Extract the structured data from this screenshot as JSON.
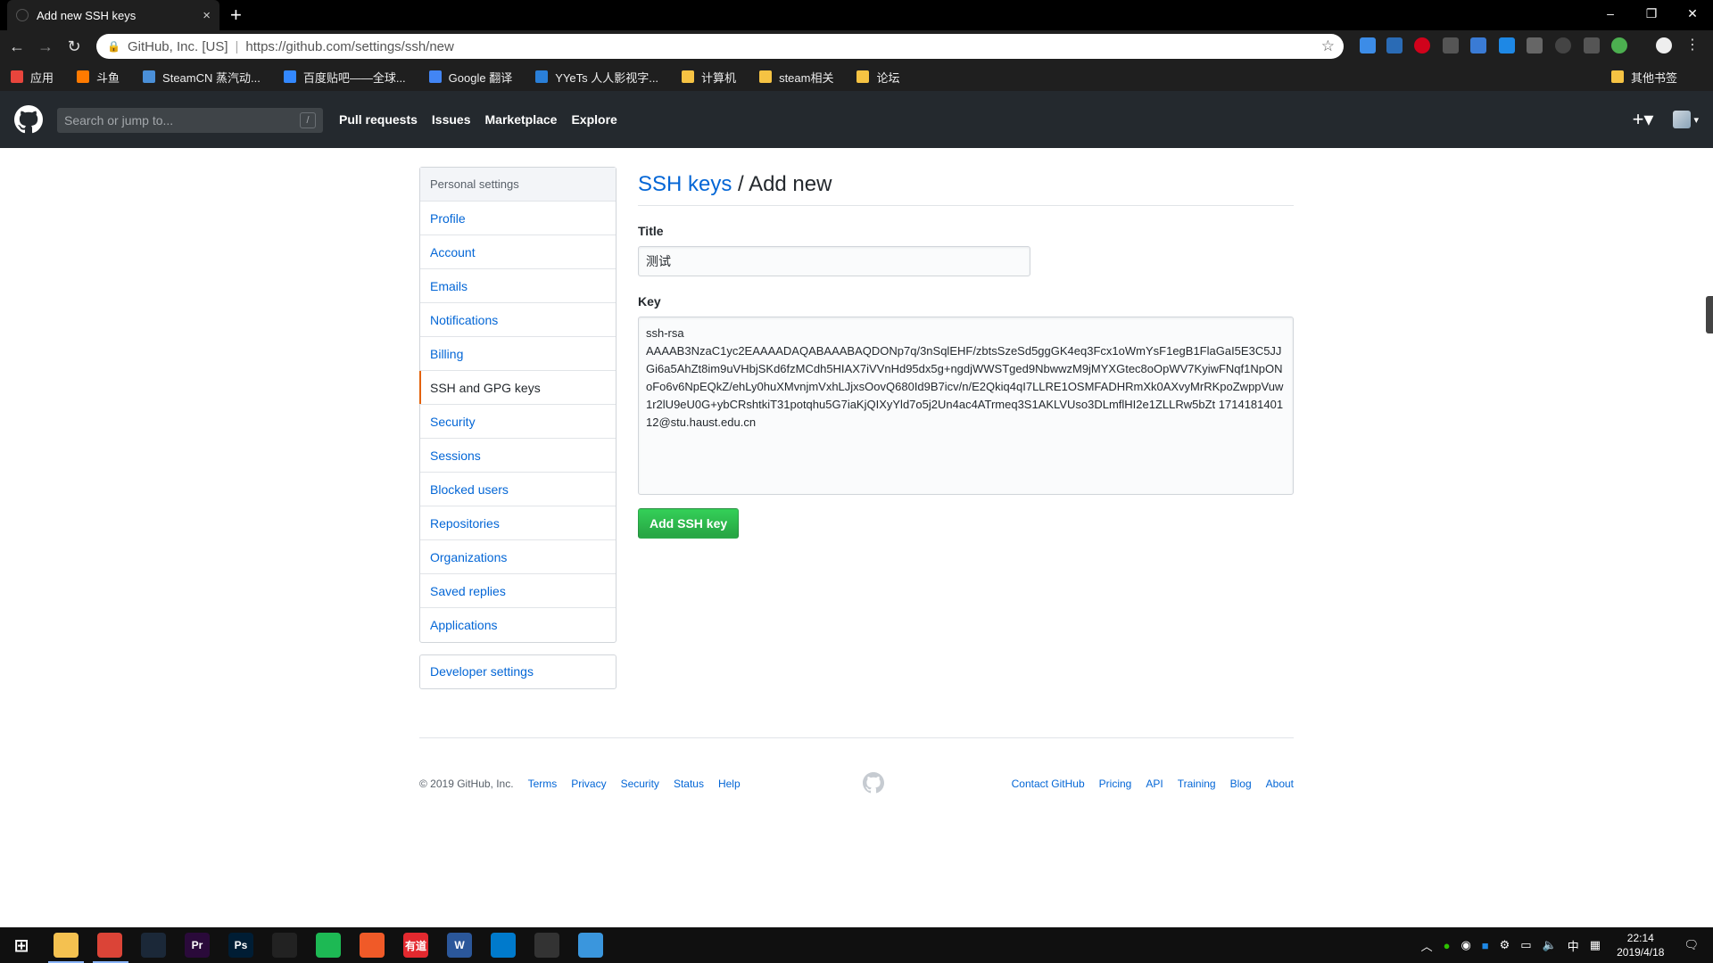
{
  "browser": {
    "tab_title": "Add new SSH keys",
    "tab_close": "×",
    "new_tab": "+",
    "window_controls": [
      "–",
      "❐",
      "✕"
    ],
    "ev_label": "GitHub, Inc. [US]",
    "url": "https://github.com/settings/ssh/new",
    "bookmarks": [
      {
        "label": "应用",
        "color": "#e8453c"
      },
      {
        "label": "斗鱼",
        "color": "#ff7a00"
      },
      {
        "label": "SteamCN 蒸汽动...",
        "color": "#4a8fd8"
      },
      {
        "label": "百度贴吧——全球...",
        "color": "#3388ff"
      },
      {
        "label": "Google 翻译",
        "color": "#4285f4"
      },
      {
        "label": "YYeTs 人人影视字...",
        "color": "#2a7fd8"
      },
      {
        "label": "计算机",
        "color": "#f6c343"
      },
      {
        "label": "steam相关",
        "color": "#f6c343"
      },
      {
        "label": "论坛",
        "color": "#f6c343"
      }
    ],
    "other_bookmarks": "其他书签"
  },
  "gh_header": {
    "search_placeholder": "Search or jump to...",
    "slash_key": "/",
    "nav": [
      "Pull requests",
      "Issues",
      "Marketplace",
      "Explore"
    ],
    "plus": "+▾",
    "avatar_caret": "▾"
  },
  "sidebar": {
    "heading": "Personal settings",
    "items": [
      "Profile",
      "Account",
      "Emails",
      "Notifications",
      "Billing",
      "SSH and GPG keys",
      "Security",
      "Sessions",
      "Blocked users",
      "Repositories",
      "Organizations",
      "Saved replies",
      "Applications"
    ],
    "selected_index": 5,
    "developer_settings": "Developer settings"
  },
  "main": {
    "crumb": "SSH keys",
    "divider": " / ",
    "heading": "Add new",
    "title_label": "Title",
    "title_value": "测试",
    "key_label": "Key",
    "key_value": "ssh-rsa\nAAAAB3NzaC1yc2EAAAADAQABAAABAQDONp7q/3nSqlEHF/zbtsSzeSd5ggGK4eq3Fcx1oWmYsF1egB1FlaGaI5E3C5JJGi6a5AhZt8im9uVHbjSKd6fzMCdh5HIAX7iVVnHd95dx5g+ngdjWWSTged9NbwwzM9jMYXGtec8oOpWV7KyiwFNqf1NpONoFo6v6NpEQkZ/ehLy0huXMvnjmVxhLJjxsOovQ680Id9B7icv/n/E2Qkiq4qI7LLRE1OSMFADHRmXk0AXvyMrRKpoZwppVuw1r2lU9eU0G+ybCRshtkiT31potqhu5G7iaKjQIXyYld7o5j2Un4ac4ATrmeq3S1AKLVUso3DLmflHI2e1ZLLRw5bZt 171418140112@stu.haust.edu.cn",
    "submit": "Add SSH key"
  },
  "footer": {
    "copyright": "© 2019 GitHub, Inc.",
    "left_links": [
      "Terms",
      "Privacy",
      "Security",
      "Status",
      "Help"
    ],
    "right_links": [
      "Contact GitHub",
      "Pricing",
      "API",
      "Training",
      "Blog",
      "About"
    ]
  },
  "taskbar": {
    "apps": [
      {
        "name": "file-explorer",
        "glyph": "",
        "color": "#f4c150"
      },
      {
        "name": "chrome",
        "glyph": "",
        "color": "#db4437"
      },
      {
        "name": "steam",
        "glyph": "",
        "color": "#1b2838"
      },
      {
        "name": "premiere",
        "glyph": "Pr",
        "color": "#2a0a3a"
      },
      {
        "name": "photoshop",
        "glyph": "Ps",
        "color": "#001d34"
      },
      {
        "name": "vpn",
        "glyph": "",
        "color": "#222"
      },
      {
        "name": "spotify",
        "glyph": "",
        "color": "#1db954"
      },
      {
        "name": "video",
        "glyph": "",
        "color": "#f05a28"
      },
      {
        "name": "youdao",
        "glyph": "有道",
        "color": "#e3292f"
      },
      {
        "name": "word",
        "glyph": "W",
        "color": "#2b579a"
      },
      {
        "name": "vscode",
        "glyph": "",
        "color": "#007acc"
      },
      {
        "name": "git",
        "glyph": "",
        "color": "#333"
      },
      {
        "name": "app",
        "glyph": "",
        "color": "#3a96dd"
      }
    ],
    "ime": "中",
    "time": "22:14",
    "date": "2019/4/18"
  }
}
